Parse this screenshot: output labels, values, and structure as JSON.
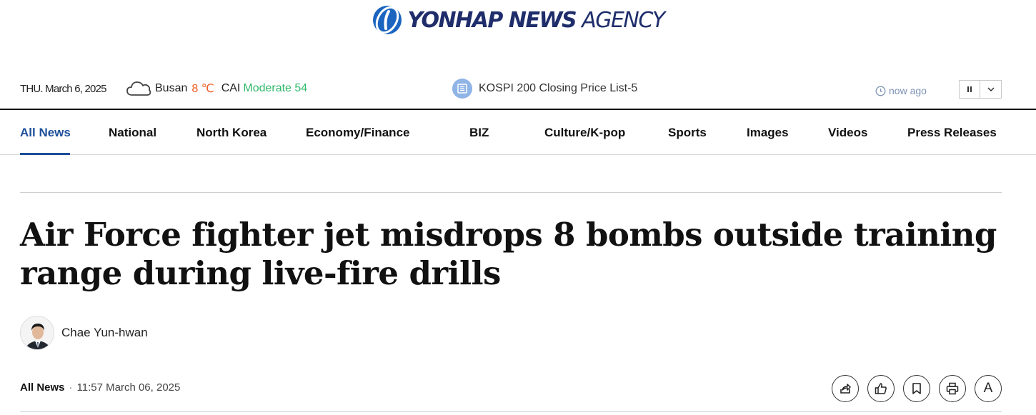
{
  "logo": {
    "bold_text": "YONHAP NEWS",
    "light_text": "AGENCY"
  },
  "infobar": {
    "date": "THU. March 6, 2025",
    "city": "Busan",
    "temperature": "8 ℃",
    "cai_label": "CAI",
    "cai_value": "Moderate 54",
    "ticker_text": "KOSPI 200 Closing Price List-5",
    "time_ago": "now ago"
  },
  "colors": {
    "accent": "#1d4f9a",
    "temperature": "#f05a22",
    "cai": "#2fb86a"
  },
  "nav": {
    "items": [
      {
        "label": "All News"
      },
      {
        "label": "National"
      },
      {
        "label": "North Korea"
      },
      {
        "label": "Economy/Finance"
      },
      {
        "label": "BIZ"
      },
      {
        "label": "Culture/K-pop"
      },
      {
        "label": "Sports"
      },
      {
        "label": "Images"
      },
      {
        "label": "Videos"
      },
      {
        "label": "Press Releases"
      }
    ]
  },
  "article": {
    "headline": "Air Force fighter jet misdrops 8 bombs outside training range during live-fire drills",
    "author": "Chae Yun-hwan",
    "section": "All News",
    "timestamp": "11:57 March 06, 2025"
  },
  "actions": {
    "share_icon": "share-icon",
    "like_icon": "thumbs-up-icon",
    "bookmark_icon": "bookmark-icon",
    "print_icon": "print-icon",
    "font_label": "A"
  }
}
